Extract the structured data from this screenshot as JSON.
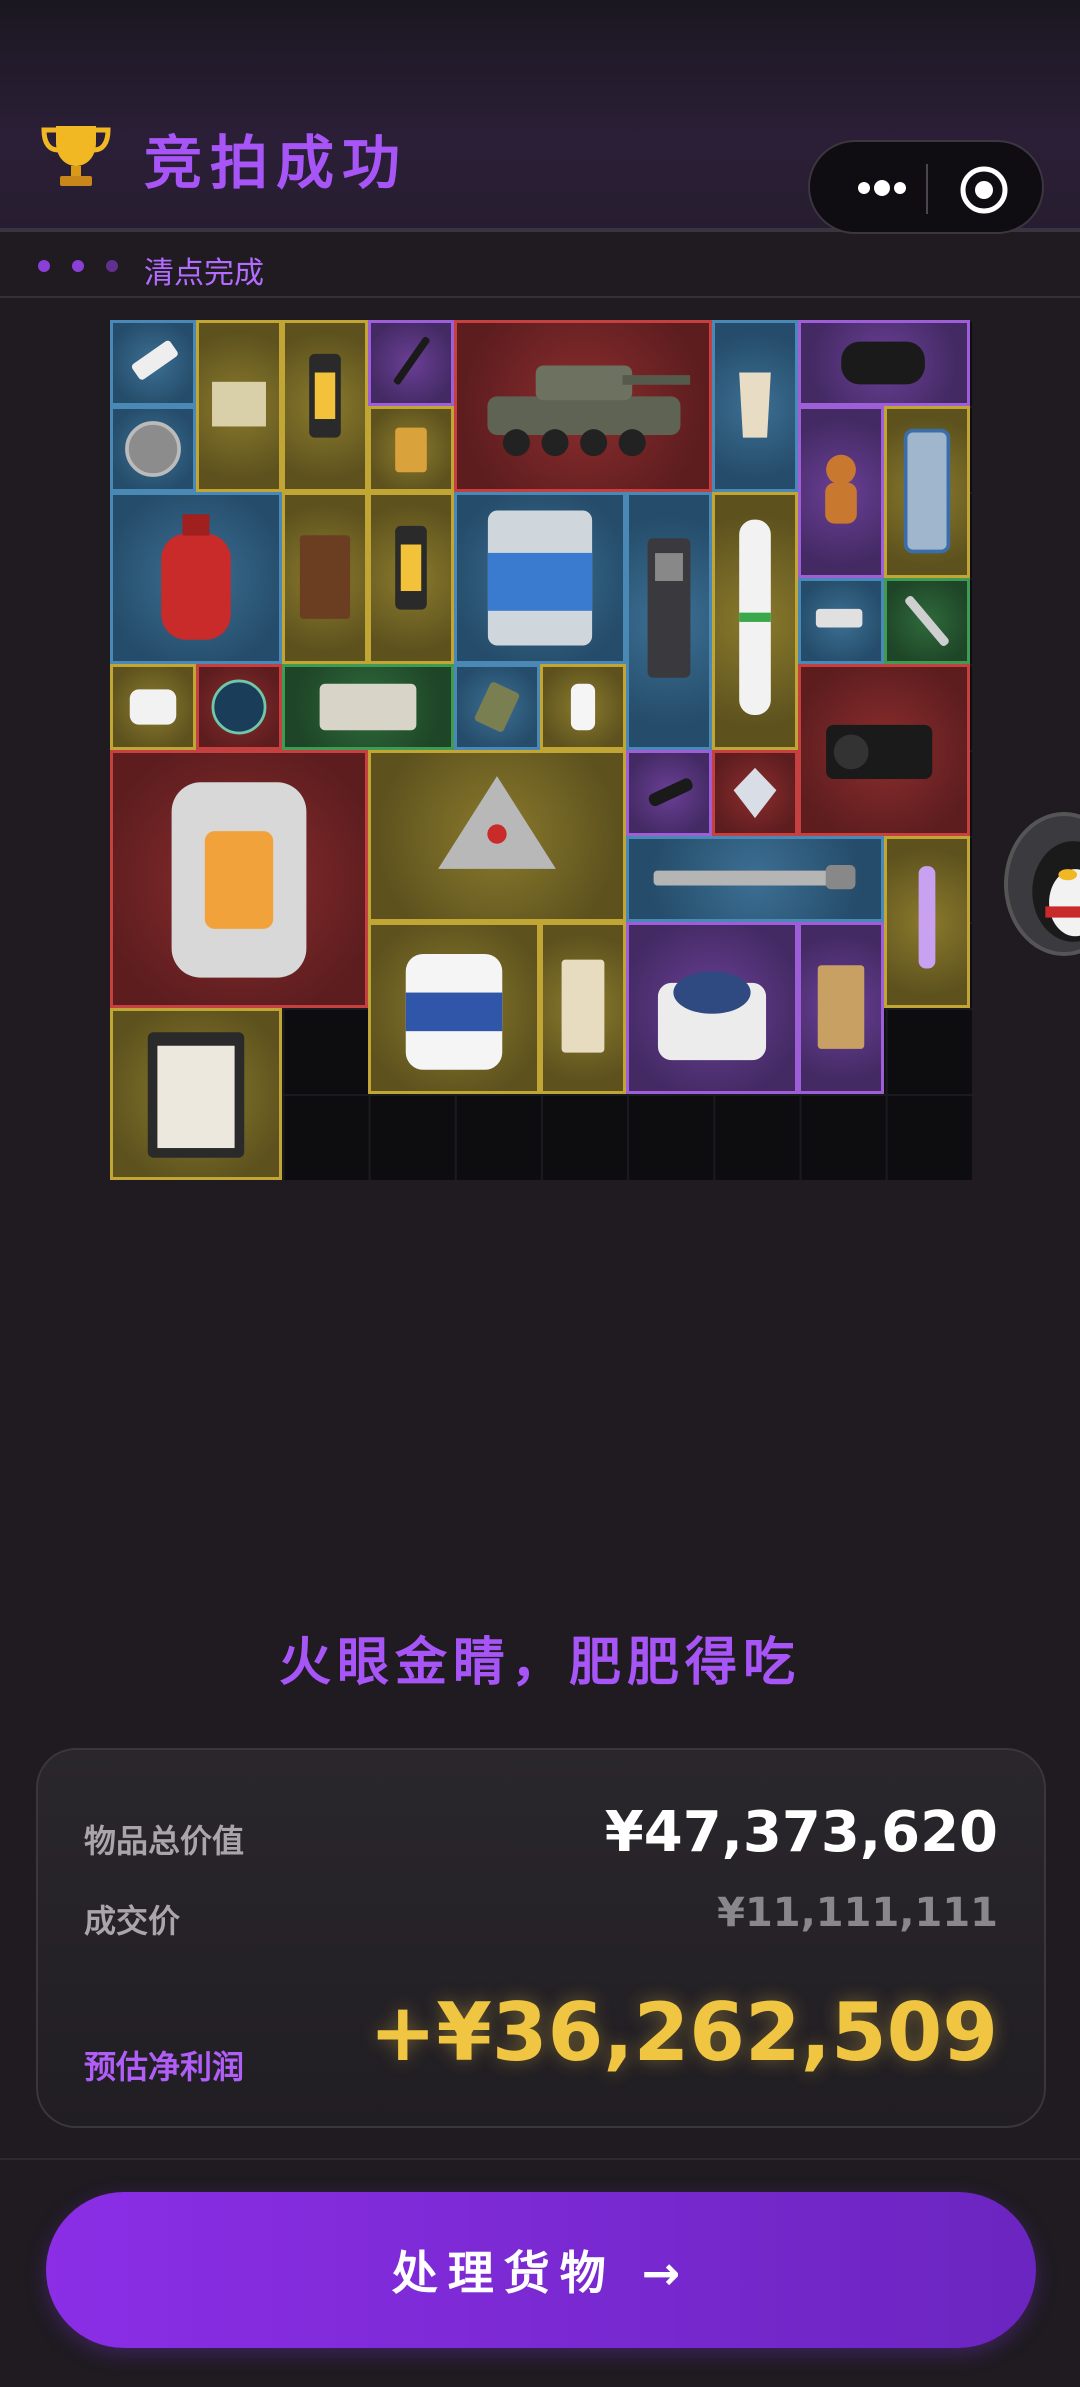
{
  "header": {
    "title": "竞拍成功",
    "progress_label": "清点完成"
  },
  "grid": {
    "items": [
      {
        "name": "thermometer",
        "color": "blue"
      },
      {
        "name": "old-coin",
        "color": "blue"
      },
      {
        "name": "old-map",
        "color": "yellow"
      },
      {
        "name": "gold-machine",
        "color": "yellow"
      },
      {
        "name": "pen",
        "color": "purple"
      },
      {
        "name": "lighter",
        "color": "yellow"
      },
      {
        "name": "tank",
        "color": "red"
      },
      {
        "name": "moka-pot",
        "color": "blue"
      },
      {
        "name": "camera-lens",
        "color": "purple"
      },
      {
        "name": "gingerbread",
        "color": "purple"
      },
      {
        "name": "tool-case",
        "color": "yellow"
      },
      {
        "name": "gas-cylinder",
        "color": "blue"
      },
      {
        "name": "leather-journal",
        "color": "yellow"
      },
      {
        "name": "gold-machine-2",
        "color": "yellow"
      },
      {
        "name": "paint-can",
        "color": "blue"
      },
      {
        "name": "atm-device",
        "color": "blue"
      },
      {
        "name": "oxygen-tank",
        "color": "yellow"
      },
      {
        "name": "cctv-camera",
        "color": "blue"
      },
      {
        "name": "wrench",
        "color": "green"
      },
      {
        "name": "pulse-oximeter",
        "color": "yellow"
      },
      {
        "name": "glass-orb",
        "color": "red"
      },
      {
        "name": "cloth-bundle",
        "color": "green"
      },
      {
        "name": "ration-pack",
        "color": "blue"
      },
      {
        "name": "hand-sanitizer",
        "color": "yellow"
      },
      {
        "name": "camcorder",
        "color": "red"
      },
      {
        "name": "reactor-core",
        "color": "red"
      },
      {
        "name": "pendant",
        "color": "yellow"
      },
      {
        "name": "flashlight",
        "color": "purple"
      },
      {
        "name": "diamond",
        "color": "red"
      },
      {
        "name": "saw",
        "color": "blue"
      },
      {
        "name": "uv-lamp",
        "color": "yellow"
      },
      {
        "name": "detergent-jug",
        "color": "yellow"
      },
      {
        "name": "coffee-box",
        "color": "yellow"
      },
      {
        "name": "centrifuge",
        "color": "purple"
      },
      {
        "name": "parcel",
        "color": "purple"
      },
      {
        "name": "clipboard",
        "color": "yellow"
      }
    ]
  },
  "slogan": "火眼金睛，肥肥得吃",
  "summary": {
    "total_label": "物品总价值",
    "total_value": "¥47,373,620",
    "deal_label": "成交价",
    "deal_value": "¥11,111,111",
    "profit_label": "预估净利润",
    "profit_value": "+¥36,262,509"
  },
  "action_button": "处理货物 →",
  "colors": {
    "accent": "#a855f7",
    "profit": "#f0c542",
    "button": "#8b2ee6"
  }
}
